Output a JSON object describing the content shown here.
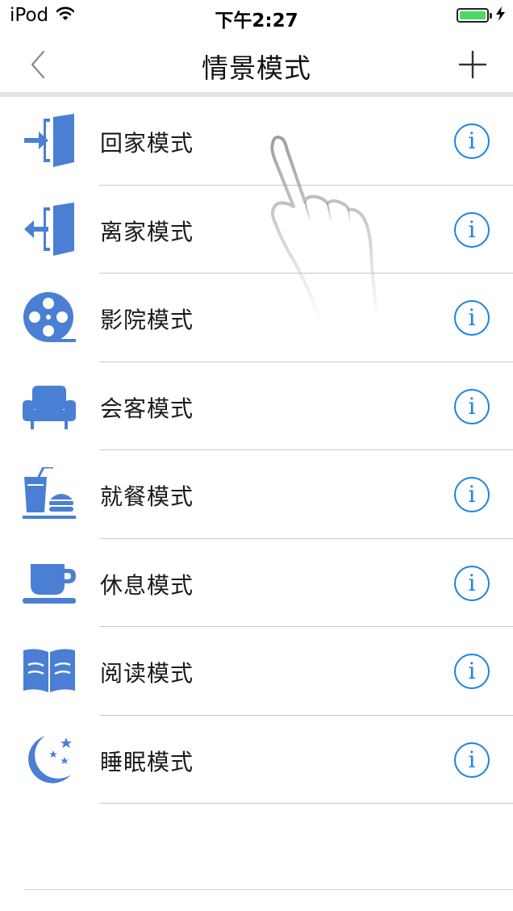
{
  "status_bar": {
    "device": "iPod",
    "time": "下午2:27",
    "icons": [
      "wifi-icon",
      "battery-icon",
      "charging-bolt-icon"
    ],
    "battery_color": "#4cd964"
  },
  "nav": {
    "title": "情景模式",
    "back_icon": "chevron-left-icon",
    "add_icon": "plus-icon"
  },
  "scenes": [
    {
      "label": "回家模式",
      "icon": "enter-door-icon",
      "info": "i"
    },
    {
      "label": "离家模式",
      "icon": "exit-door-icon",
      "info": "i"
    },
    {
      "label": "影院模式",
      "icon": "film-reel-icon",
      "info": "i"
    },
    {
      "label": "会客模式",
      "icon": "sofa-icon",
      "info": "i"
    },
    {
      "label": "就餐模式",
      "icon": "meal-icon",
      "info": "i"
    },
    {
      "label": "休息模式",
      "icon": "coffee-cup-icon",
      "info": "i"
    },
    {
      "label": "阅读模式",
      "icon": "open-book-icon",
      "info": "i"
    },
    {
      "label": "睡眠模式",
      "icon": "moon-stars-icon",
      "info": "i"
    }
  ],
  "colors": {
    "icon_blue": "#4a7fd4",
    "info_blue": "#1b82e8"
  },
  "overlay": {
    "icon": "tap-hand-icon"
  }
}
